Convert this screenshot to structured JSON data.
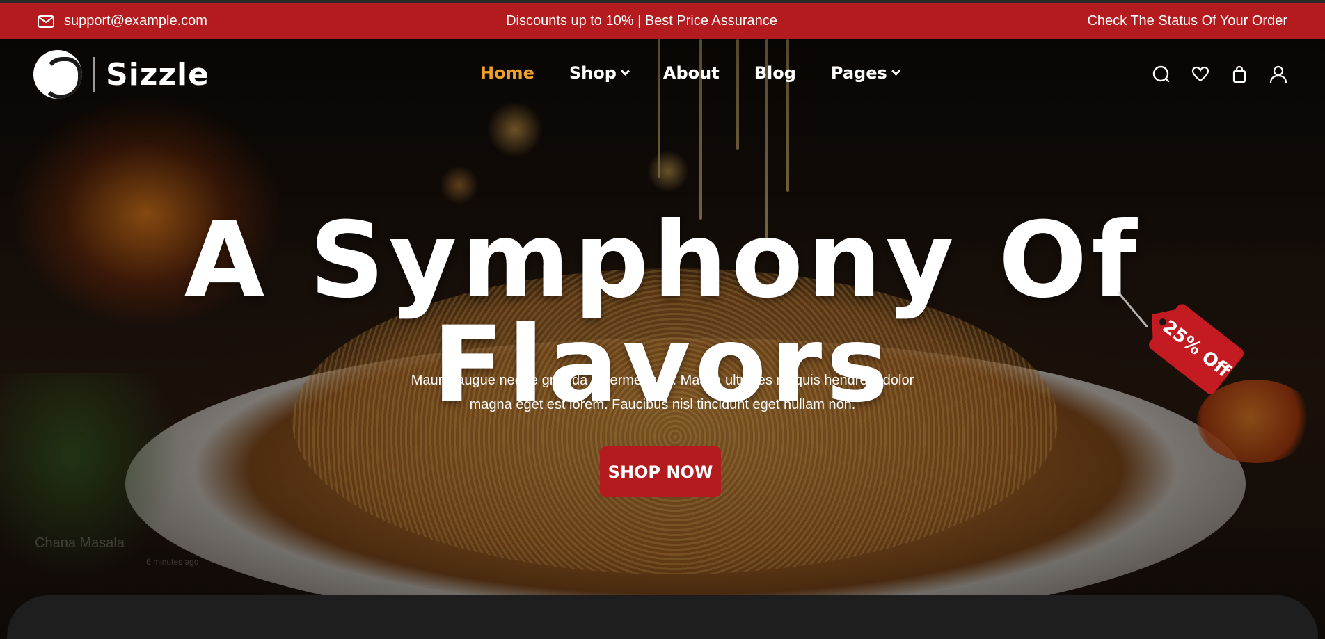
{
  "topbar": {
    "email": "support@example.com",
    "promo": "Discounts up to 10% | Best Price Assurance",
    "order_status": "Check The Status Of Your Order"
  },
  "brand": {
    "name": "Sizzle"
  },
  "nav": {
    "items": [
      {
        "label": "Home",
        "active": true
      },
      {
        "label": "Shop",
        "dropdown": true
      },
      {
        "label": "About"
      },
      {
        "label": "Blog"
      },
      {
        "label": "Pages",
        "dropdown": true
      }
    ]
  },
  "icons": [
    "search-icon",
    "heart-icon",
    "bag-icon",
    "user-icon"
  ],
  "hero": {
    "headline": "A Symphony Of Flavors",
    "tag": "25% Off",
    "description_line1": "Mauris augue neque gravida in fermentum. Massa ultricies mi quis hendrerit dolor",
    "description_line2": "magna eget est lorem. Faucibus nisl tincidunt eget nullam non.",
    "cta": "SHOP NOW"
  },
  "toast": {
    "title": "Chana Masala",
    "time": "6 minutes ago"
  },
  "colors": {
    "brand_red": "#b31b1f",
    "active_nav": "#f0a12a"
  }
}
